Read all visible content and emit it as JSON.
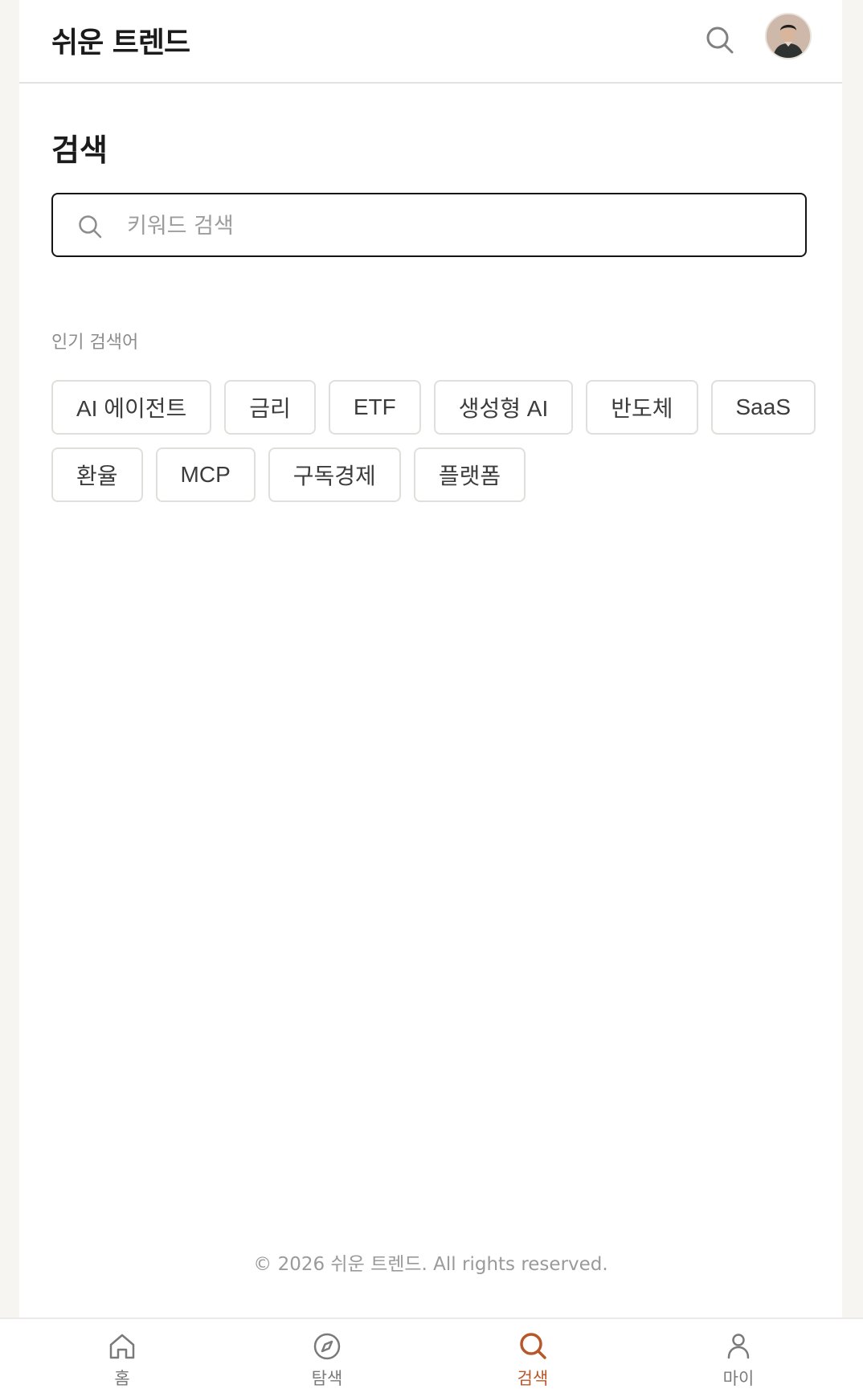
{
  "header": {
    "logo": "쉬운 트렌드"
  },
  "main": {
    "title": "검색",
    "search_placeholder": "키워드 검색",
    "popular_label": "인기 검색어",
    "popular_keywords": [
      "AI 에이전트",
      "금리",
      "ETF",
      "생성형 AI",
      "반도체",
      "SaaS",
      "환율",
      "MCP",
      "구독경제",
      "플랫폼"
    ]
  },
  "footer": {
    "copyright": "© 2026 쉬운 트렌드. All rights reserved."
  },
  "tabbar": {
    "items": [
      {
        "label": "홈",
        "icon": "home-icon"
      },
      {
        "label": "탐색",
        "icon": "compass-icon"
      },
      {
        "label": "검색",
        "icon": "search-icon"
      },
      {
        "label": "마이",
        "icon": "user-icon"
      }
    ],
    "active": "검색"
  },
  "colors": {
    "accent": "#b8582a",
    "background": "#f6f5f1",
    "border": "#e0dfdb"
  }
}
